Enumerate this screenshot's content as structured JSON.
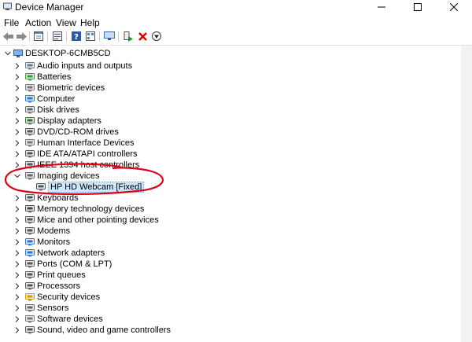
{
  "window": {
    "title": "Device Manager"
  },
  "menu": [
    "File",
    "Action",
    "View",
    "Help"
  ],
  "toolbar": [
    "back-arrow-icon",
    "forward-arrow-icon",
    "properties-icon",
    "show-hidden-icon",
    "help-icon",
    "view-icon",
    "scan-monitor-icon",
    "update-driver-icon",
    "uninstall-icon",
    "disable-icon"
  ],
  "tree": {
    "root": "DESKTOP-6CMB5CD",
    "items": [
      {
        "label": "Audio inputs and outputs",
        "icon": "speaker-icon"
      },
      {
        "label": "Batteries",
        "icon": "battery-icon"
      },
      {
        "label": "Biometric devices",
        "icon": "biometric-icon"
      },
      {
        "label": "Computer",
        "icon": "computer-icon"
      },
      {
        "label": "Disk drives",
        "icon": "disk-icon"
      },
      {
        "label": "Display adapters",
        "icon": "display-adapter-icon"
      },
      {
        "label": "DVD/CD-ROM drives",
        "icon": "dvd-icon"
      },
      {
        "label": "Human Interface Devices",
        "icon": "hid-icon"
      },
      {
        "label": "IDE ATA/ATAPI controllers",
        "icon": "ide-icon"
      },
      {
        "label": "IEEE 1394 host controllers",
        "icon": "ieee-icon"
      },
      {
        "label": "Imaging devices",
        "icon": "camera-icon",
        "expanded": true
      },
      {
        "label": "HP HD Webcam [Fixed]",
        "icon": "webcam-icon",
        "child": true,
        "selected": true
      },
      {
        "label": "Keyboards",
        "icon": "keyboard-icon"
      },
      {
        "label": "Memory technology devices",
        "icon": "memory-icon"
      },
      {
        "label": "Mice and other pointing devices",
        "icon": "mouse-icon"
      },
      {
        "label": "Modems",
        "icon": "modem-icon"
      },
      {
        "label": "Monitors",
        "icon": "monitor-icon"
      },
      {
        "label": "Network adapters",
        "icon": "network-icon"
      },
      {
        "label": "Ports (COM & LPT)",
        "icon": "port-icon"
      },
      {
        "label": "Print queues",
        "icon": "printer-icon"
      },
      {
        "label": "Processors",
        "icon": "processor-icon"
      },
      {
        "label": "Security devices",
        "icon": "security-icon"
      },
      {
        "label": "Sensors",
        "icon": "sensor-icon"
      },
      {
        "label": "Software devices",
        "icon": "software-icon"
      },
      {
        "label": "Sound, video and game controllers",
        "icon": "sound-icon"
      }
    ]
  },
  "colors": {
    "selection": "#cce8ff",
    "annotation": "#e0001a"
  }
}
